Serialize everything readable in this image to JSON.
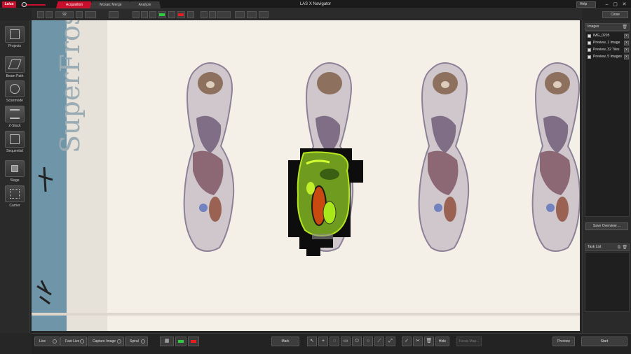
{
  "app": {
    "logo_text": "Leica",
    "title": "LAS X Navigator",
    "help_label": "Help",
    "close_label": "Close",
    "window_controls": [
      "minimize-icon",
      "restore-icon",
      "close-icon"
    ]
  },
  "tabs": [
    {
      "label": "Acquisition",
      "active": true
    },
    {
      "label": "Mosaic Merge",
      "active": false
    },
    {
      "label": "Analyze",
      "active": false
    }
  ],
  "toolbar": {
    "zoom_value": "92"
  },
  "sidebar": {
    "items": [
      {
        "label": "Projects",
        "icon": "projects-icon"
      },
      {
        "label": "Beam Path",
        "icon": "beam-path-icon"
      },
      {
        "label": "Scanmode",
        "icon": "scanmode-icon"
      },
      {
        "label": "Z-Stack",
        "icon": "z-stack-icon"
      },
      {
        "label": "Sequential",
        "icon": "sequential-icon"
      },
      {
        "label": "Stage",
        "icon": "stage-icon"
      },
      {
        "label": "Carrier",
        "icon": "carrier-icon"
      }
    ]
  },
  "slide": {
    "label_text": "SuperFrost"
  },
  "right_panel": {
    "images_header": "Images",
    "images": [
      {
        "name": "IMG_0205",
        "checked": true
      },
      {
        "name": "Preview, 1 Image",
        "checked": true
      },
      {
        "name": "Preview, 32 Tiles",
        "checked": true
      },
      {
        "name": "Preview, 5 Images",
        "checked": true
      }
    ],
    "save_overview_label": "Save Overview ...",
    "task_list_header": "Task List"
  },
  "bottom": {
    "live_label": "Live",
    "fast_live_label": "Fast Live",
    "capture_label": "Capture Image",
    "spiral_label": "Spiral",
    "mark_label": "Mark",
    "hide_label": "Hide",
    "focus_map_label": "Focus Map...",
    "preview_label": "Preview",
    "start_label": "Start"
  },
  "colors": {
    "accent": "#c8102e",
    "background": "#262626",
    "slide_label_blue": "#6f95a8"
  }
}
